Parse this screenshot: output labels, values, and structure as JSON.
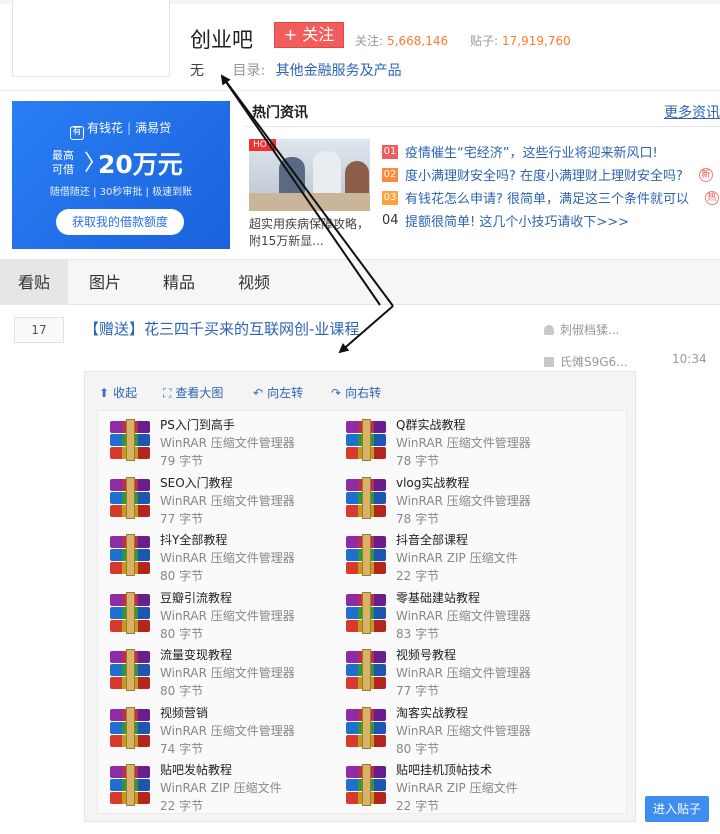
{
  "forum": {
    "name": "创业吧",
    "follow_label": "+ 关注",
    "followers_label": "关注:",
    "followers": "5,668,146",
    "posts_label": "贴子:",
    "posts": "17,919,760",
    "sign": "无",
    "directory_label": "目录:",
    "directory": "其他金融服务及产品"
  },
  "ad": {
    "brand": "有钱花",
    "partner": "满易贷",
    "small_text": "最高可借",
    "amount": "20万元",
    "tags": "随借随还 | 30秒审批 | 极速到账",
    "button": "获取我的借款额度"
  },
  "hot": {
    "title": "热门资讯",
    "more": "更多资讯",
    "image_badge": "HOT",
    "caption": "超实用疾病保障攻略，附15万新显...",
    "items": [
      {
        "num": "01",
        "text": "疫情催生“宅经济”，这些行业将迎来新风口!",
        "num_color": "#f15c5c",
        "tag": ""
      },
      {
        "num": "02",
        "text": "度小满理财安全吗? 在度小满理财上理财安全吗?",
        "num_color": "#ff8a3d",
        "tag": "新"
      },
      {
        "num": "03",
        "text": "有钱花怎么申请? 很简单，满足这三个条件就可以",
        "num_color": "#ffa23d",
        "tag": "热"
      },
      {
        "num": "04",
        "text": "提额很简单! 这几个小技巧请收下>>>",
        "num_color": "",
        "tag": ""
      }
    ]
  },
  "tabs": [
    {
      "label": "看贴"
    },
    {
      "label": "图片"
    },
    {
      "label": "精品"
    },
    {
      "label": "视频"
    }
  ],
  "thread": {
    "reply_count": "17",
    "title": "【赠送】花三四千买来的互联网创-业课程",
    "author": "刺俶档猱...",
    "last_reply_user": "氏傩S9G6...",
    "time": "10:34"
  },
  "viewer": {
    "collapse": "收起",
    "view_large": "查看大图",
    "rotate_left": "向左转",
    "rotate_right": "向右转",
    "files": [
      {
        "name": "PS入门到高手",
        "type": "WinRAR 压缩文件管理器",
        "size": "79 字节"
      },
      {
        "name": "Q群实战教程",
        "type": "WinRAR 压缩文件管理器",
        "size": "78 字节"
      },
      {
        "name": "SEO入门教程",
        "type": "WinRAR 压缩文件管理器",
        "size": "77 字节"
      },
      {
        "name": "vlog实战教程",
        "type": "WinRAR 压缩文件管理器",
        "size": "78 字节"
      },
      {
        "name": "抖Y全部教程",
        "type": "WinRAR 压缩文件管理器",
        "size": "80 字节"
      },
      {
        "name": "抖音全部课程",
        "type": "WinRAR ZIP 压缩文件",
        "size": "22 字节"
      },
      {
        "name": "豆瓣引流教程",
        "type": "WinRAR 压缩文件管理器",
        "size": "80 字节"
      },
      {
        "name": "零基础建站教程",
        "type": "WinRAR 压缩文件管理器",
        "size": "83 字节"
      },
      {
        "name": "流量变现教程",
        "type": "WinRAR 压缩文件管理器",
        "size": "80 字节"
      },
      {
        "name": "视频号教程",
        "type": "WinRAR 压缩文件管理器",
        "size": "77 字节"
      },
      {
        "name": "视频营销",
        "type": "WinRAR 压缩文件管理器",
        "size": "74 字节"
      },
      {
        "name": "淘客实战教程",
        "type": "WinRAR 压缩文件管理器",
        "size": "80 字节"
      },
      {
        "name": "贴吧发帖教程",
        "type": "WinRAR ZIP 压缩文件",
        "size": "22 字节"
      },
      {
        "name": "贴吧挂机顶帖技术",
        "type": "WinRAR ZIP 压缩文件",
        "size": "22 字节"
      }
    ]
  },
  "enter_button": "进入贴子"
}
